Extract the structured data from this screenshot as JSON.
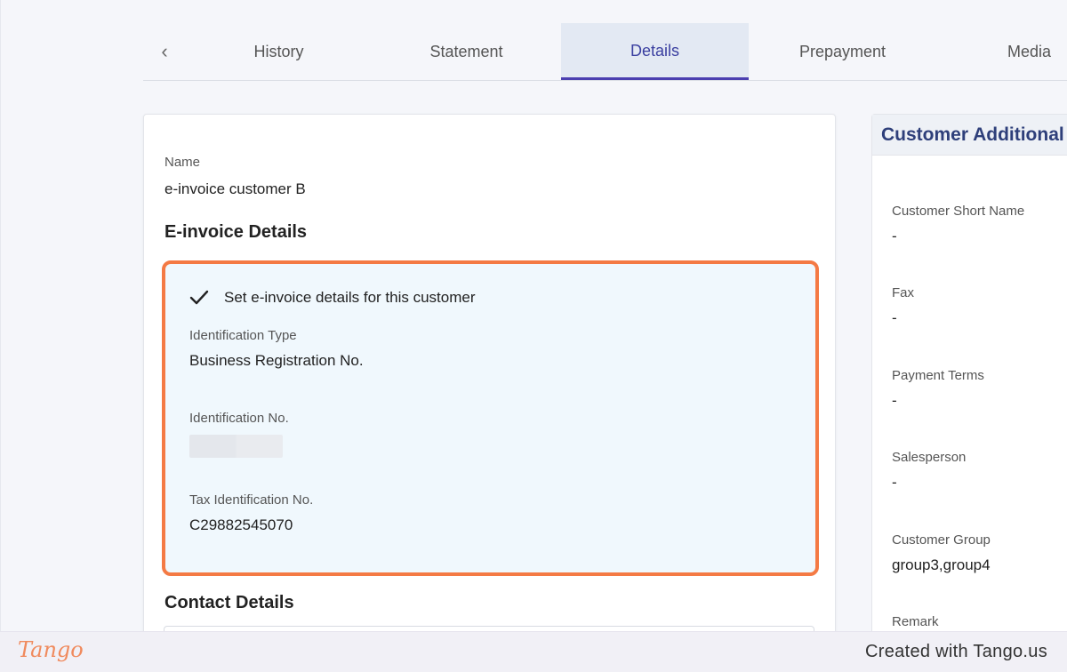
{
  "tabs": {
    "back_icon": "chevron-left-icon",
    "items": [
      {
        "label": "History"
      },
      {
        "label": "Statement"
      },
      {
        "label": "Details"
      },
      {
        "label": "Prepayment"
      },
      {
        "label": "Media"
      }
    ],
    "active": "Details"
  },
  "main": {
    "name_label": "Name",
    "name_value": "e-invoice customer B",
    "einvoice_title": "E-invoice Details",
    "einvoice": {
      "checkbox_label": "Set e-invoice details for this customer",
      "checked": true,
      "id_type_label": "Identification Type",
      "id_type_value": "Business Registration No.",
      "id_no_label": "Identification No.",
      "tax_id_label": "Tax Identification No.",
      "tax_id_value": "C29882545070"
    },
    "contact_title": "Contact Details"
  },
  "side": {
    "title": "Customer Additional",
    "fields": [
      {
        "label": "Customer Short Name",
        "value": "-"
      },
      {
        "label": "Fax",
        "value": "-"
      },
      {
        "label": "Payment Terms",
        "value": "-"
      },
      {
        "label": "Salesperson",
        "value": "-"
      },
      {
        "label": "Customer Group",
        "value": "group3,group4"
      },
      {
        "label": "Remark",
        "value": ""
      }
    ]
  },
  "footer": {
    "logo": "Tango",
    "credit": "Created with Tango.us"
  },
  "colors": {
    "accent": "#4b3fb0",
    "highlight_border": "#f47a44",
    "panel_title": "#2e3f7a"
  }
}
